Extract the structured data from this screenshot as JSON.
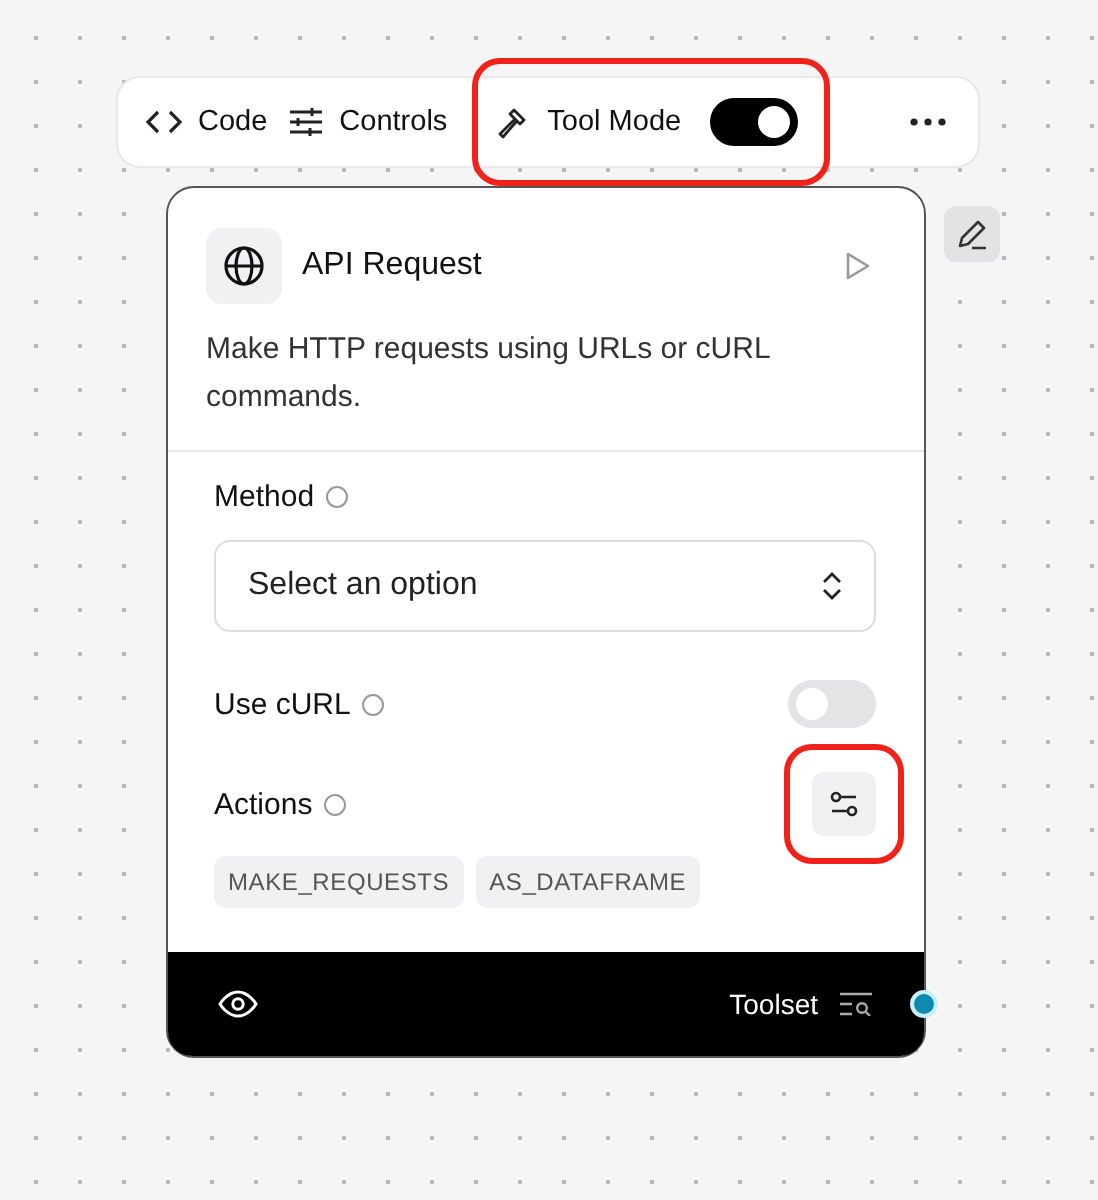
{
  "toolbar": {
    "items": [
      {
        "kind": "code",
        "label": "Code"
      },
      {
        "kind": "controls",
        "label": "Controls"
      },
      {
        "kind": "toggle",
        "label": "Tool Mode",
        "on": true,
        "highlighted": true
      }
    ]
  },
  "node": {
    "title": "API Request",
    "description": "Make HTTP requests using URLs or cURL commands.",
    "fields": [
      {
        "kind": "select",
        "label": "Method",
        "placeholder": "Select an option"
      },
      {
        "kind": "toggle",
        "label": "Use cURL",
        "on": false
      },
      {
        "kind": "actions",
        "label": "Actions",
        "highlighted": true,
        "tags": [
          "MAKE_REQUESTS",
          "AS_DATAFRAME"
        ]
      }
    ],
    "footer": {
      "label": "Toolset"
    }
  }
}
